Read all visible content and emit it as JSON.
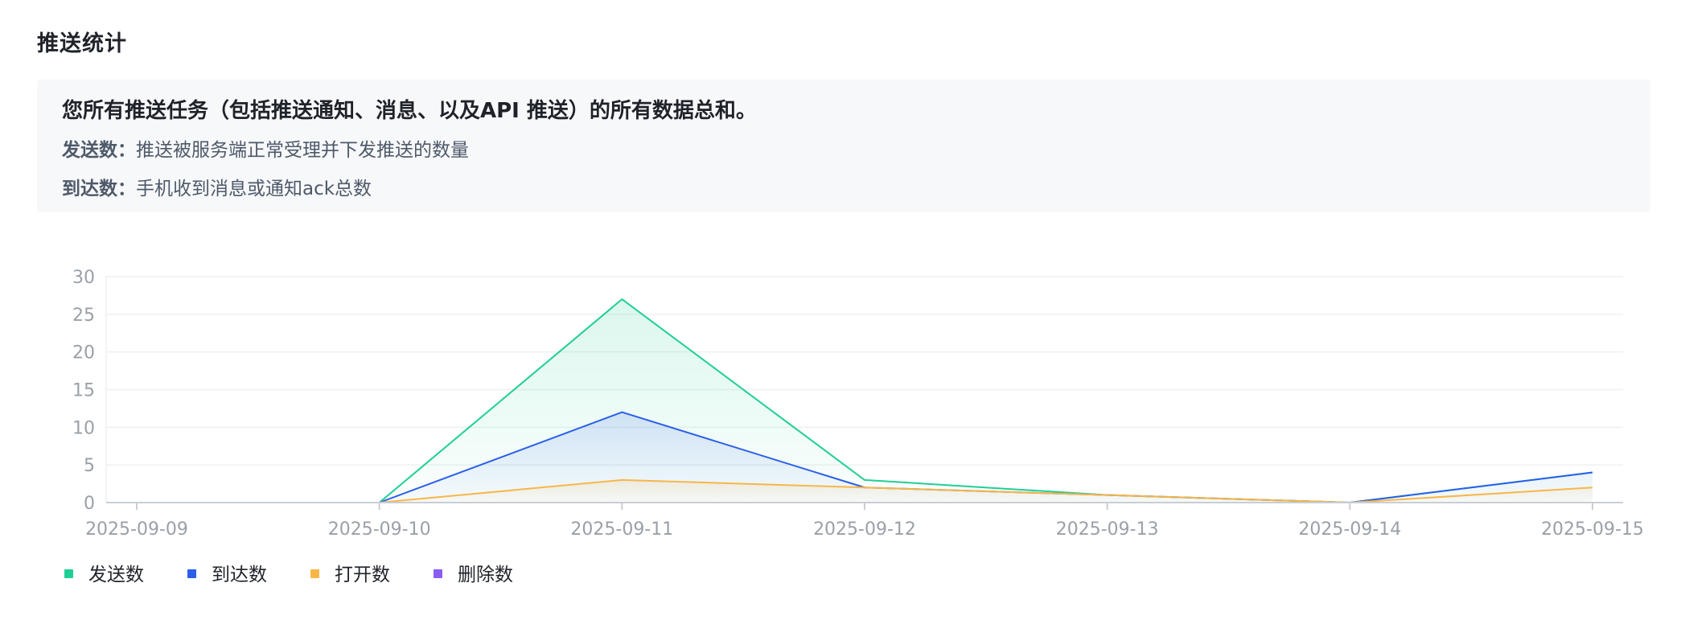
{
  "header": {
    "title": "推送统计"
  },
  "info": {
    "headline": "您所有推送任务（包括推送通知、消息、以及API 推送）的所有数据总和。",
    "sent_key": "发送数：",
    "sent_desc": "推送被服务端正常受理并下发推送的数量",
    "arrived_key": "到达数：",
    "arrived_desc": "手机收到消息或通知ack总数"
  },
  "chart_data": {
    "type": "line",
    "x": [
      "2025-09-09",
      "2025-09-10",
      "2025-09-11",
      "2025-09-12",
      "2025-09-13",
      "2025-09-14",
      "2025-09-15"
    ],
    "ylim": [
      0,
      30
    ],
    "yticks": [
      0,
      5,
      10,
      15,
      20,
      25,
      30
    ],
    "grid": true,
    "legend_position": "bottom-left",
    "series": [
      {
        "name": "发送数",
        "values": [
          0,
          0,
          27,
          3,
          1,
          0,
          4
        ],
        "color": "#1fcf94",
        "area": true
      },
      {
        "name": "到达数",
        "values": [
          0,
          0,
          12,
          2,
          1,
          0,
          4
        ],
        "color": "#2b5fe8",
        "area": true
      },
      {
        "name": "打开数",
        "values": [
          0,
          0,
          3,
          2,
          1,
          0,
          2
        ],
        "color": "#f7b648",
        "area": true
      },
      {
        "name": "删除数",
        "values": [
          0,
          0,
          0,
          0,
          0,
          0,
          0
        ],
        "color": "#8b5cf0",
        "area": false
      }
    ]
  }
}
